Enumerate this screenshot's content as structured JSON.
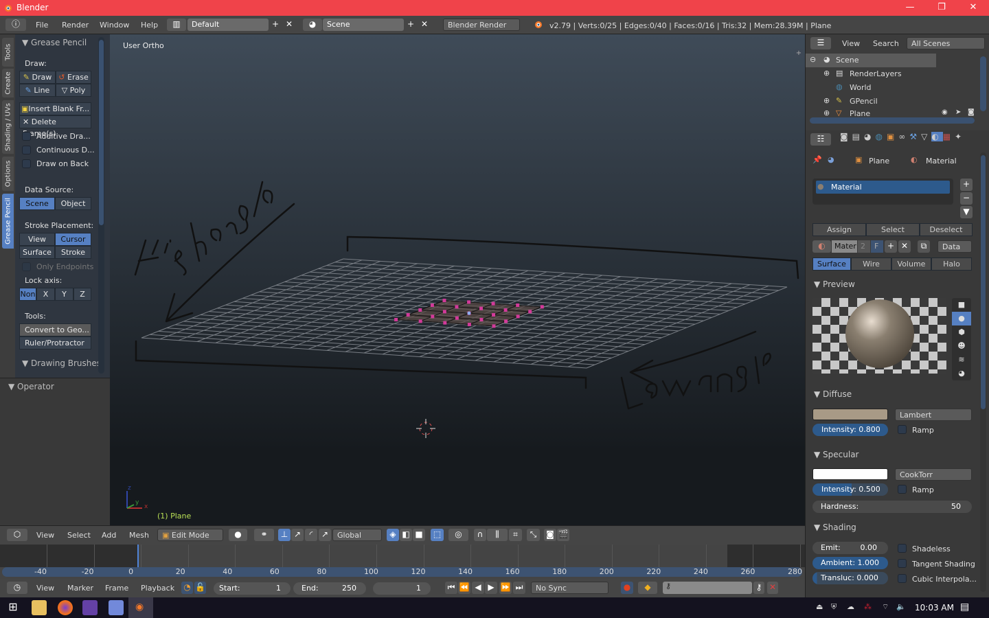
{
  "window": {
    "title": "Blender",
    "minimize": "—",
    "maximize": "❐",
    "close": "✕"
  },
  "menubar": {
    "menus": [
      "File",
      "Render",
      "Window",
      "Help"
    ],
    "layout": "Default",
    "scene": "Scene",
    "engine": "Blender Render",
    "status": "v2.79 | Verts:0/25 | Edges:0/40 | Faces:0/16 | Tris:32 | Mem:28.39M | Plane"
  },
  "tool_tabs": [
    "Tools",
    "Create",
    "Shading / UVs",
    "Options",
    "Grease Pencil"
  ],
  "tool_shelf": {
    "panel_title": "Grease Pencil",
    "draw_label": "Draw:",
    "draw_buttons": [
      "Draw",
      "Erase",
      "Line",
      "Poly"
    ],
    "insert_blank": "Insert Blank Fr...",
    "delete_frames": "Delete Frame(s)",
    "checkboxes": [
      "Additive Dra...",
      "Continuous D...",
      "Draw on Back"
    ],
    "data_source_label": "Data Source:",
    "data_source": [
      "Scene",
      "Object"
    ],
    "data_source_selected": "Scene",
    "stroke_label": "Stroke Placement:",
    "stroke_options": [
      "View",
      "Cursor",
      "Surface",
      "Stroke"
    ],
    "stroke_selected": "Cursor",
    "only_endpoints": "Only Endpoints",
    "lock_label": "Lock axis:",
    "lock_options": [
      "Non",
      "X",
      "Y",
      "Z"
    ],
    "lock_selected": "Non",
    "tools_label": "Tools:",
    "convert": "Convert to Geo...",
    "ruler": "Ruler/Protractor",
    "drawing_brushes": "Drawing Brushes",
    "operator": "Operator"
  },
  "viewport": {
    "view_label": "User Ortho",
    "object_label": "(1) Plane",
    "annotations": [
      "High angle",
      "Low angle"
    ],
    "axes": {
      "x": "x",
      "y": "y",
      "z": "z"
    }
  },
  "view3d_header": {
    "menus": [
      "View",
      "Select",
      "Add",
      "Mesh"
    ],
    "mode": "Edit Mode",
    "orientation": "Global"
  },
  "timeline": {
    "ticks": [
      -40,
      -20,
      0,
      20,
      40,
      60,
      80,
      100,
      120,
      140,
      160,
      180,
      200,
      220,
      240,
      260,
      280
    ],
    "current_frame": 0,
    "menus": [
      "View",
      "Marker",
      "Frame",
      "Playback"
    ],
    "start_label": "Start:",
    "start": "1",
    "end_label": "End:",
    "end": "250",
    "frame": "1",
    "sync": "No Sync"
  },
  "outliner": {
    "menus": [
      "View",
      "Search"
    ],
    "filter": "All Scenes",
    "items": [
      {
        "label": "Scene",
        "selected": true
      },
      {
        "label": "RenderLayers"
      },
      {
        "label": "World"
      },
      {
        "label": "GPencil"
      },
      {
        "label": "Plane"
      }
    ]
  },
  "properties": {
    "breadcrumb": [
      "Plane",
      "Material"
    ],
    "slot": "Material",
    "assign": [
      "Assign",
      "Select",
      "Deselect"
    ],
    "mat_name": "Mater",
    "mat_users": "2",
    "fake": "F",
    "link": "Data",
    "types": [
      "Surface",
      "Wire",
      "Volume",
      "Halo"
    ],
    "type_selected": "Surface",
    "preview_title": "Preview",
    "diffuse": {
      "title": "Diffuse",
      "color": "#a89a86",
      "shader": "Lambert",
      "intensity_label": "Intensity:",
      "intensity": "0.800",
      "intensity_frac": 0.8,
      "ramp": "Ramp"
    },
    "specular": {
      "title": "Specular",
      "color": "#ffffff",
      "shader": "CookTorr",
      "intensity_label": "Intensity:",
      "intensity": "0.500",
      "intensity_frac": 0.5,
      "ramp": "Ramp",
      "hardness_label": "Hardness:",
      "hardness": "50"
    },
    "shading": {
      "title": "Shading",
      "emit_label": "Emit:",
      "emit": "0.00",
      "ambient_label": "Ambient:",
      "ambient": "1.000",
      "transluc_label": "Transluc:",
      "transluc": "0.000",
      "checks": [
        "Shadeless",
        "Tangent Shading",
        "Cubic Interpola..."
      ]
    }
  },
  "taskbar": {
    "clock": "10:03 AM"
  }
}
